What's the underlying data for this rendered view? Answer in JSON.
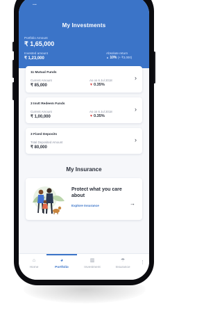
{
  "header": {
    "status_time": "...",
    "title": "My Investments",
    "portfolio_label": "Portfolio Amount",
    "portfolio_value": "₹ 1,65,000",
    "invested_label": "Invested amount",
    "invested_value": "₹ 1,23,000",
    "return_label": "Absolute return",
    "return_value": "10%",
    "return_amount": "(+ ₹3,000)"
  },
  "cards": [
    {
      "title": "11 Mutual Funds",
      "amount_label": "Current Amount",
      "amount": "₹ 85,000",
      "date_label": "As on 6 Jul 2018",
      "return": "0.35%"
    },
    {
      "title": "3 InvIt Redeem Funds",
      "amount_label": "Current Amount",
      "amount": "₹ 1,00,000",
      "date_label": "As on 6 Jul 2018",
      "return": "0.35%"
    },
    {
      "title": "3 Fixed Deposits",
      "amount_label": "Total Deposited Amount",
      "amount": "₹ 80,000"
    }
  ],
  "insurance": {
    "section_title": "My Insurance",
    "headline": "Protect what you care about",
    "link": "Explore Insurance",
    "arrow": "→"
  },
  "nav": [
    {
      "label": "Home",
      "icon": "home-icon"
    },
    {
      "label": "Portfolio",
      "icon": "pie-chart-icon",
      "active": true
    },
    {
      "label": "Investment",
      "icon": "bar-chart-icon"
    },
    {
      "label": "Insurance",
      "icon": "umbrella-icon"
    }
  ],
  "colors": {
    "primary": "#3b74c8",
    "background": "#f6f7fa",
    "down": "#d33a3a"
  }
}
